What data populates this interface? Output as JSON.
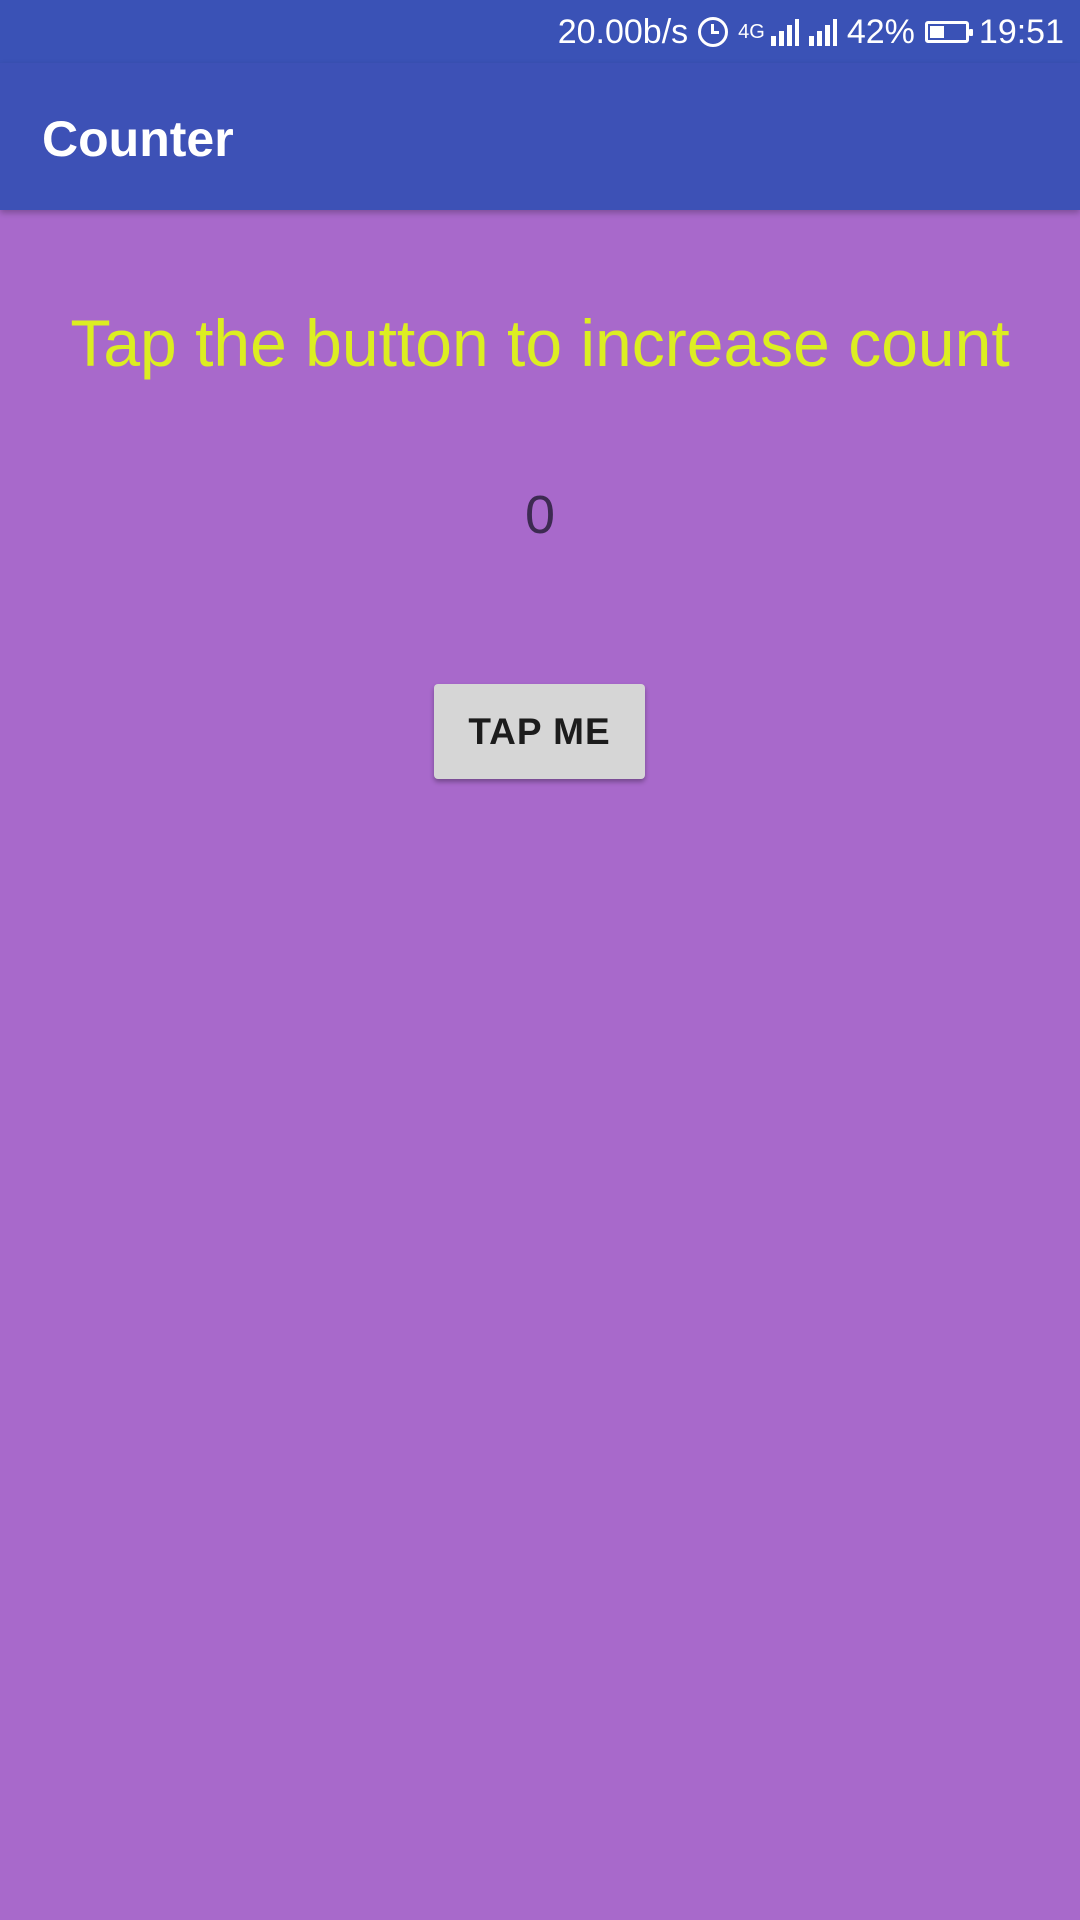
{
  "status_bar": {
    "net_speed": "20.00b/s",
    "alarm_icon": "alarm-clock-icon",
    "network_type": "4G",
    "battery_percent": "42%",
    "battery_level": 0.42,
    "time": "19:51"
  },
  "app_bar": {
    "title": "Counter",
    "color": "#3D51B6"
  },
  "main": {
    "background": "#A869CB",
    "instruction": "Tap the button to increase count",
    "instruction_color": "#DCEE21",
    "count": "0",
    "button_label": "TAP ME"
  }
}
